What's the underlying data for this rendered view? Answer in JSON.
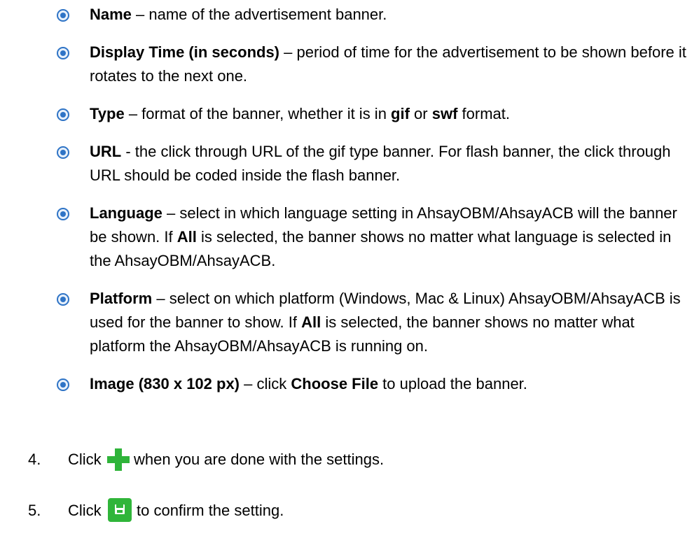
{
  "bullets": [
    {
      "term": "Name",
      "description": " – name of the advertisement banner."
    },
    {
      "term": "Display Time (in seconds)",
      "description": " – period of time for the advertisement to be shown before it rotates to the next one."
    },
    {
      "term": "Type",
      "description_1": " – format of the banner, whether it is in ",
      "bold_1": "gif",
      "description_2": " or ",
      "bold_2": "swf",
      "description_3": " format."
    },
    {
      "term": "URL",
      "description": " - the click through URL of the gif type banner. For flash banner, the click through URL should be coded inside the flash banner."
    },
    {
      "term": "Language",
      "description_1": " – select in which language setting in AhsayOBM/AhsayACB will the banner be shown. If ",
      "bold_1": "All",
      "description_2": " is selected, the banner shows no matter what language is selected in the AhsayOBM/AhsayACB."
    },
    {
      "term": "Platform",
      "description_1": " – select on which platform (Windows, Mac & Linux) AhsayOBM/AhsayACB is used for the banner to show. If ",
      "bold_1": "All",
      "description_2": " is selected, the banner shows no matter what platform the AhsayOBM/AhsayACB is running on."
    },
    {
      "term": "Image (830 x 102 px)",
      "description_1": " – click ",
      "bold_1": "Choose File",
      "description_2": " to upload the banner."
    }
  ],
  "steps": [
    {
      "number": "4.",
      "click": "Click",
      "rest": "when you are done with the settings.",
      "icon": "plus-icon"
    },
    {
      "number": "5.",
      "click": "Click",
      "rest": "to confirm the setting.",
      "icon": "save-icon"
    }
  ],
  "colors": {
    "bullet_ring": "#2f74c6",
    "bullet_fill": "#5aa0ea",
    "plus_green": "#2fb43a",
    "save_green": "#30b53a"
  }
}
